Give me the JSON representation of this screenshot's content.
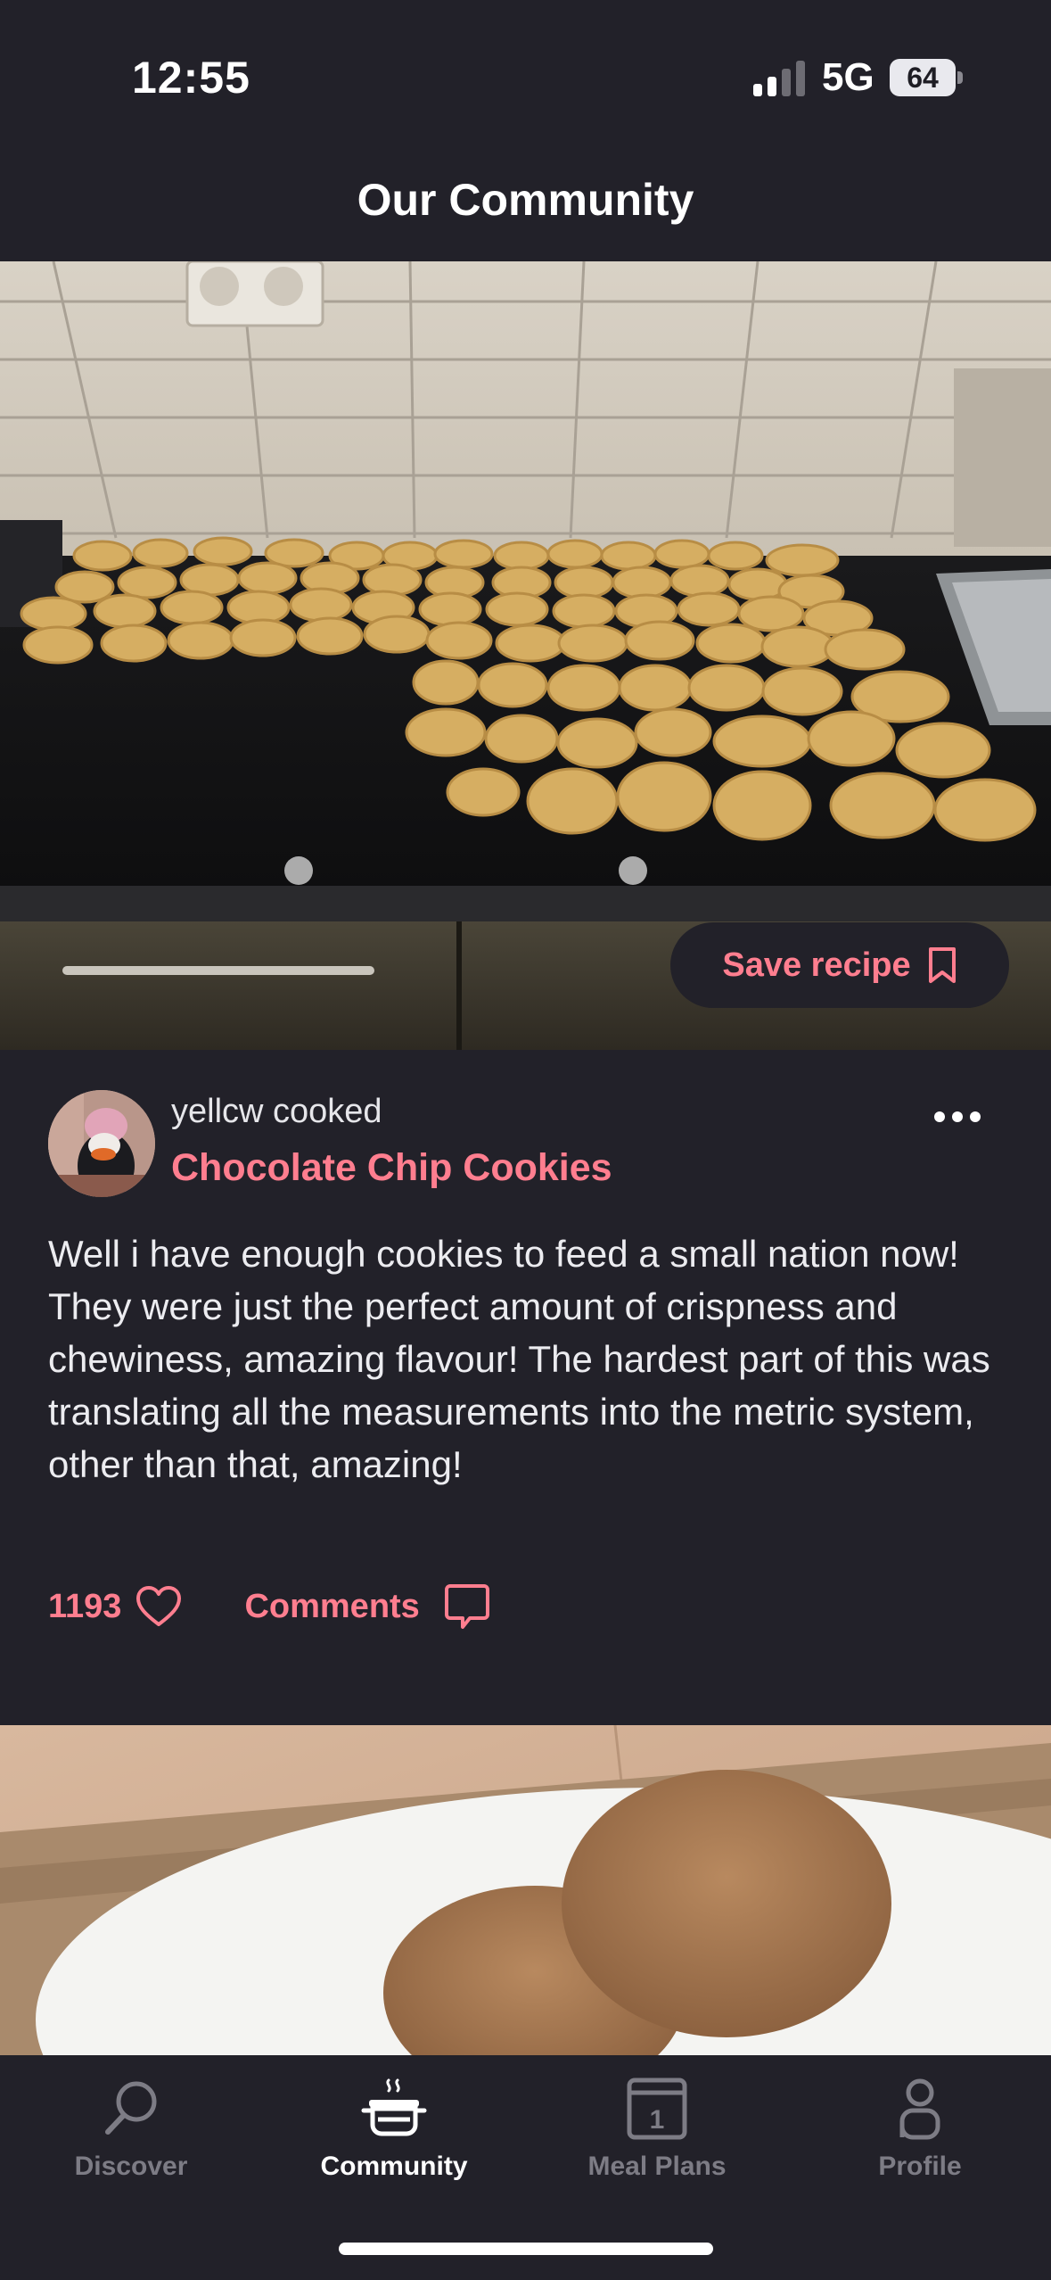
{
  "status_bar": {
    "time": "12:55",
    "network": "5G",
    "battery": "64"
  },
  "header": {
    "title": "Our Community"
  },
  "post": {
    "save_label": "Save recipe",
    "author_line": "yellcw cooked",
    "recipe_title": "Chocolate Chip Cookies",
    "body": "Well i have enough cookies to feed a small nation now! They were just the perfect amount of crispness and chewiness, amazing flavour! The hardest part of this was translating all the measurements into the metric system, other than that, amazing!",
    "likes": "1193",
    "comments_label": "Comments"
  },
  "tabs": [
    {
      "label": "Discover",
      "icon": "search-icon"
    },
    {
      "label": "Community",
      "icon": "cooking-pot-icon"
    },
    {
      "label": "Meal Plans",
      "icon": "calendar-icon"
    },
    {
      "label": "Profile",
      "icon": "person-icon"
    }
  ],
  "colors": {
    "background": "#222129",
    "accent": "#ff7e8f",
    "inactive": "#7d7c85"
  }
}
